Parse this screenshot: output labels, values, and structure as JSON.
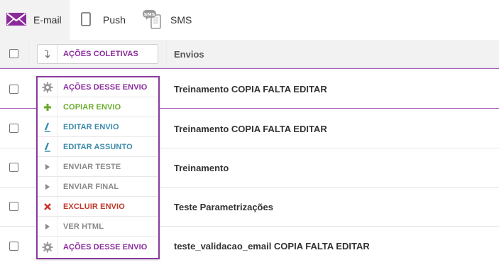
{
  "tabs": [
    {
      "label": "E-mail",
      "icon": "envelope-icon",
      "active": true
    },
    {
      "label": "Push",
      "icon": "phone-icon",
      "active": false
    },
    {
      "label": "SMS",
      "icon": "sms-phone-icon",
      "active": false
    }
  ],
  "table": {
    "bulk_actions_label": "AÇÕES COLETIVAS",
    "column_header": "Envios",
    "rows": [
      {
        "name": "Treinamento COPIA FALTA EDITAR",
        "selected": true
      },
      {
        "name": "Treinamento COPIA FALTA EDITAR",
        "selected": false
      },
      {
        "name": "Treinamento",
        "selected": false
      },
      {
        "name": "Teste Parametrizações",
        "selected": false
      },
      {
        "name": "teste_validacao_email COPIA FALTA EDITAR",
        "selected": false
      }
    ]
  },
  "actions_menu": {
    "items": [
      {
        "label": "AÇÕES DESSE ENVIO",
        "icon": "gear-icon",
        "color": "#8a2a9b"
      },
      {
        "label": "COPIAR ENVIO",
        "icon": "plus-icon",
        "color": "#6aaa2a"
      },
      {
        "label": "EDITAR ENVIO",
        "icon": "pencil-icon",
        "color": "#3a8aaa"
      },
      {
        "label": "EDITAR ASSUNTO",
        "icon": "pencil-icon",
        "color": "#3a8aaa"
      },
      {
        "label": "ENVIAR TESTE",
        "icon": "caret-right-icon",
        "color": "#8a8a8a"
      },
      {
        "label": "ENVIAR FINAL",
        "icon": "caret-right-icon",
        "color": "#8a8a8a"
      },
      {
        "label": "EXCLUIR ENVIO",
        "icon": "x-icon",
        "color": "#c0392b"
      },
      {
        "label": "VER HTML",
        "icon": "caret-right-icon",
        "color": "#8a8a8a"
      },
      {
        "label": "AÇÕES DESSE ENVIO",
        "icon": "gear-icon",
        "color": "#8a2a9b"
      }
    ]
  },
  "colors": {
    "accent": "#8a2a9b",
    "selected_border": "#a85fb8"
  }
}
